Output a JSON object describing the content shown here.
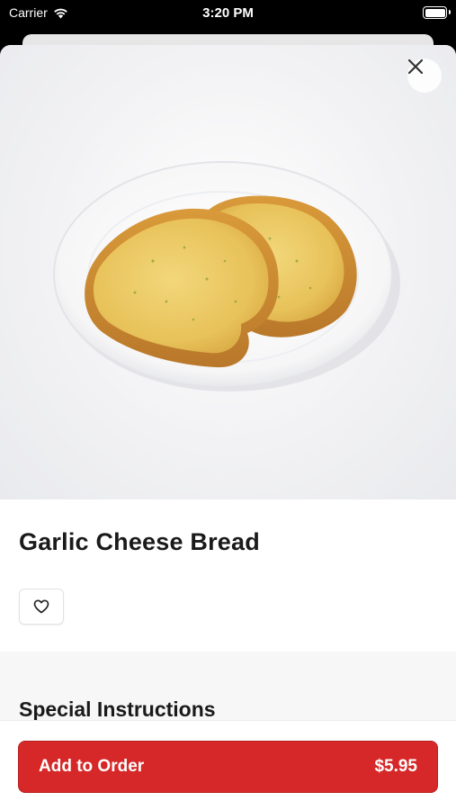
{
  "status_bar": {
    "carrier": "Carrier",
    "time": "3:20 PM"
  },
  "item": {
    "title": "Garlic Cheese Bread",
    "image_icon": "garlic-bread-photo"
  },
  "actions": {
    "close_icon": "close-icon",
    "favorite_icon": "heart-icon"
  },
  "instructions": {
    "title": "Special Instructions"
  },
  "footer": {
    "add_label": "Add to Order",
    "price": "$5.95"
  },
  "colors": {
    "accent": "#d62828",
    "background": "#ffffff",
    "section_bg": "#f7f7f7",
    "text": "#1a1a1a"
  }
}
